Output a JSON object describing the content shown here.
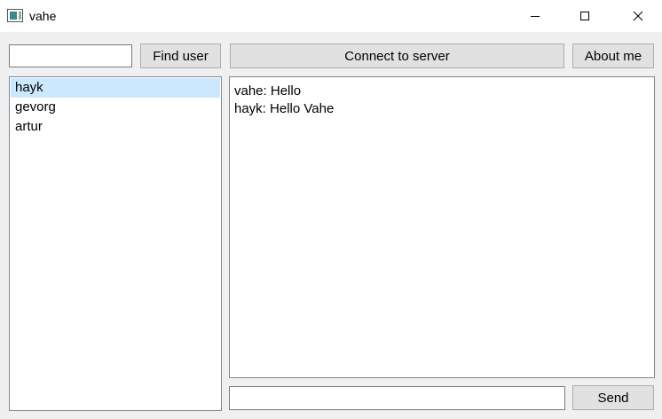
{
  "window": {
    "title": "vahe",
    "app_icon": "window-app-icon",
    "controls": [
      "minimize-icon",
      "maximize-icon",
      "close-icon"
    ]
  },
  "toolbar": {
    "search_value": "",
    "find_label": "Find user",
    "connect_label": "Connect to server",
    "about_label": "About me"
  },
  "users": {
    "items": [
      {
        "name": "hayk",
        "selected": true
      },
      {
        "name": "gevorg",
        "selected": false
      },
      {
        "name": "artur",
        "selected": false
      }
    ]
  },
  "chat": {
    "messages": [
      "vahe: Hello",
      "hayk: Hello Vahe"
    ]
  },
  "compose": {
    "message_value": "",
    "send_label": "Send"
  },
  "colors": {
    "selection": "#cce8ff",
    "button_bg": "#e1e1e1",
    "window_bg": "#f0f0f0"
  }
}
